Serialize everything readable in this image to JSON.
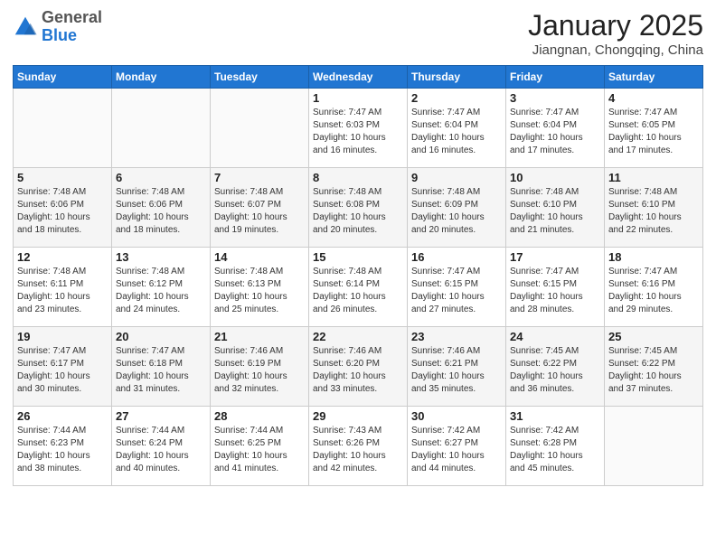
{
  "header": {
    "logo_general": "General",
    "logo_blue": "Blue",
    "month_year": "January 2025",
    "location": "Jiangnan, Chongqing, China"
  },
  "days_of_week": [
    "Sunday",
    "Monday",
    "Tuesday",
    "Wednesday",
    "Thursday",
    "Friday",
    "Saturday"
  ],
  "weeks": [
    [
      {
        "day": "",
        "info": ""
      },
      {
        "day": "",
        "info": ""
      },
      {
        "day": "",
        "info": ""
      },
      {
        "day": "1",
        "info": "Sunrise: 7:47 AM\nSunset: 6:03 PM\nDaylight: 10 hours and 16 minutes."
      },
      {
        "day": "2",
        "info": "Sunrise: 7:47 AM\nSunset: 6:04 PM\nDaylight: 10 hours and 16 minutes."
      },
      {
        "day": "3",
        "info": "Sunrise: 7:47 AM\nSunset: 6:04 PM\nDaylight: 10 hours and 17 minutes."
      },
      {
        "day": "4",
        "info": "Sunrise: 7:47 AM\nSunset: 6:05 PM\nDaylight: 10 hours and 17 minutes."
      }
    ],
    [
      {
        "day": "5",
        "info": "Sunrise: 7:48 AM\nSunset: 6:06 PM\nDaylight: 10 hours and 18 minutes."
      },
      {
        "day": "6",
        "info": "Sunrise: 7:48 AM\nSunset: 6:06 PM\nDaylight: 10 hours and 18 minutes."
      },
      {
        "day": "7",
        "info": "Sunrise: 7:48 AM\nSunset: 6:07 PM\nDaylight: 10 hours and 19 minutes."
      },
      {
        "day": "8",
        "info": "Sunrise: 7:48 AM\nSunset: 6:08 PM\nDaylight: 10 hours and 20 minutes."
      },
      {
        "day": "9",
        "info": "Sunrise: 7:48 AM\nSunset: 6:09 PM\nDaylight: 10 hours and 20 minutes."
      },
      {
        "day": "10",
        "info": "Sunrise: 7:48 AM\nSunset: 6:10 PM\nDaylight: 10 hours and 21 minutes."
      },
      {
        "day": "11",
        "info": "Sunrise: 7:48 AM\nSunset: 6:10 PM\nDaylight: 10 hours and 22 minutes."
      }
    ],
    [
      {
        "day": "12",
        "info": "Sunrise: 7:48 AM\nSunset: 6:11 PM\nDaylight: 10 hours and 23 minutes."
      },
      {
        "day": "13",
        "info": "Sunrise: 7:48 AM\nSunset: 6:12 PM\nDaylight: 10 hours and 24 minutes."
      },
      {
        "day": "14",
        "info": "Sunrise: 7:48 AM\nSunset: 6:13 PM\nDaylight: 10 hours and 25 minutes."
      },
      {
        "day": "15",
        "info": "Sunrise: 7:48 AM\nSunset: 6:14 PM\nDaylight: 10 hours and 26 minutes."
      },
      {
        "day": "16",
        "info": "Sunrise: 7:47 AM\nSunset: 6:15 PM\nDaylight: 10 hours and 27 minutes."
      },
      {
        "day": "17",
        "info": "Sunrise: 7:47 AM\nSunset: 6:15 PM\nDaylight: 10 hours and 28 minutes."
      },
      {
        "day": "18",
        "info": "Sunrise: 7:47 AM\nSunset: 6:16 PM\nDaylight: 10 hours and 29 minutes."
      }
    ],
    [
      {
        "day": "19",
        "info": "Sunrise: 7:47 AM\nSunset: 6:17 PM\nDaylight: 10 hours and 30 minutes."
      },
      {
        "day": "20",
        "info": "Sunrise: 7:47 AM\nSunset: 6:18 PM\nDaylight: 10 hours and 31 minutes."
      },
      {
        "day": "21",
        "info": "Sunrise: 7:46 AM\nSunset: 6:19 PM\nDaylight: 10 hours and 32 minutes."
      },
      {
        "day": "22",
        "info": "Sunrise: 7:46 AM\nSunset: 6:20 PM\nDaylight: 10 hours and 33 minutes."
      },
      {
        "day": "23",
        "info": "Sunrise: 7:46 AM\nSunset: 6:21 PM\nDaylight: 10 hours and 35 minutes."
      },
      {
        "day": "24",
        "info": "Sunrise: 7:45 AM\nSunset: 6:22 PM\nDaylight: 10 hours and 36 minutes."
      },
      {
        "day": "25",
        "info": "Sunrise: 7:45 AM\nSunset: 6:22 PM\nDaylight: 10 hours and 37 minutes."
      }
    ],
    [
      {
        "day": "26",
        "info": "Sunrise: 7:44 AM\nSunset: 6:23 PM\nDaylight: 10 hours and 38 minutes."
      },
      {
        "day": "27",
        "info": "Sunrise: 7:44 AM\nSunset: 6:24 PM\nDaylight: 10 hours and 40 minutes."
      },
      {
        "day": "28",
        "info": "Sunrise: 7:44 AM\nSunset: 6:25 PM\nDaylight: 10 hours and 41 minutes."
      },
      {
        "day": "29",
        "info": "Sunrise: 7:43 AM\nSunset: 6:26 PM\nDaylight: 10 hours and 42 minutes."
      },
      {
        "day": "30",
        "info": "Sunrise: 7:42 AM\nSunset: 6:27 PM\nDaylight: 10 hours and 44 minutes."
      },
      {
        "day": "31",
        "info": "Sunrise: 7:42 AM\nSunset: 6:28 PM\nDaylight: 10 hours and 45 minutes."
      },
      {
        "day": "",
        "info": ""
      }
    ]
  ]
}
